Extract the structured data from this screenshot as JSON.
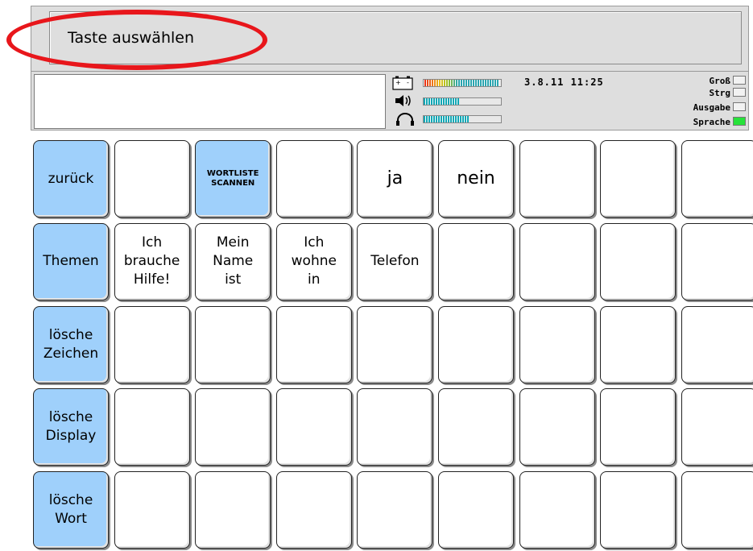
{
  "message_bar": {
    "text": "Taste auswählen"
  },
  "status": {
    "datetime": "3.8.11  11:25",
    "battery_level": 0.98,
    "volume_level": 0.46,
    "headphone_level": 0.58,
    "flags": [
      {
        "label": "Groß",
        "active": false
      },
      {
        "label": "Strg",
        "active": false
      },
      {
        "label": "Ausgabe",
        "active": false
      },
      {
        "label": "Sprache",
        "active": true
      }
    ]
  },
  "colors": {
    "function_key": "#9fd0fb",
    "active_led": "#27e23a",
    "highlight": "#e8161b"
  },
  "keys": [
    [
      "zurück",
      "",
      "WORTLISTE\nSCANNEN",
      "",
      "ja",
      "nein",
      "",
      "",
      ""
    ],
    [
      "Themen",
      "Ich\nbrauche\nHilfe!",
      "Mein\nName\nist",
      "Ich\nwohne\nin",
      "Telefon",
      "",
      "",
      "",
      ""
    ],
    [
      "lösche\nZeichen",
      "",
      "",
      "",
      "",
      "",
      "",
      "",
      ""
    ],
    [
      "lösche\nDisplay",
      "",
      "",
      "",
      "",
      "",
      "",
      "",
      ""
    ],
    [
      "lösche\nWort",
      "",
      "",
      "",
      "",
      "",
      "",
      "",
      ""
    ]
  ]
}
